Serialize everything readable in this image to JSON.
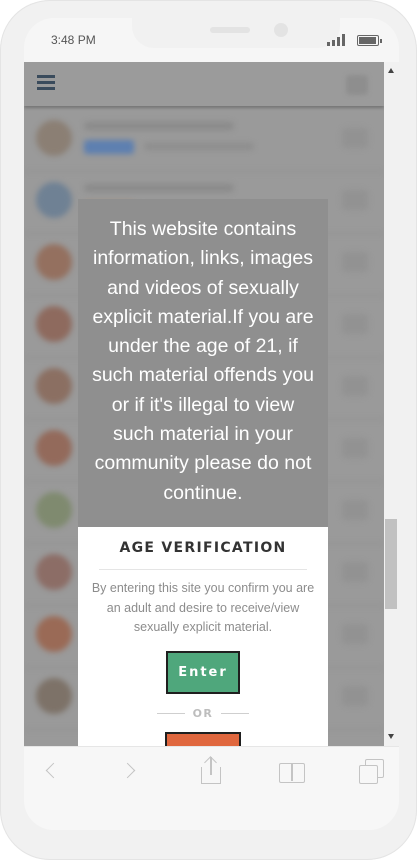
{
  "status_bar": {
    "time": "3:48 PM",
    "signal_icon": "signal-bars-icon",
    "battery_icon": "battery-icon"
  },
  "site_header": {
    "menu_icon": "hamburger-menu-icon"
  },
  "age_gate": {
    "warning_text": "This website contains information, links, images and videos of sexually explicit material.If you are under the age of 21, if such material offends you or if it's illegal to view such material in your community please do not continue.",
    "title": "AGE VERIFICATION",
    "description": "By entering this site you confirm you are an adult and desire to receive/view sexually explicit material.",
    "enter_label": "Enter",
    "or_label": "OR",
    "colors": {
      "enter_button": "#4fa77c",
      "exit_button": "#e0673e",
      "overlay_panel": "#8f8f8f"
    }
  },
  "browser_toolbar": {
    "icons": [
      "back-icon",
      "forward-icon",
      "share-icon",
      "bookmarks-icon",
      "tabs-icon"
    ]
  }
}
